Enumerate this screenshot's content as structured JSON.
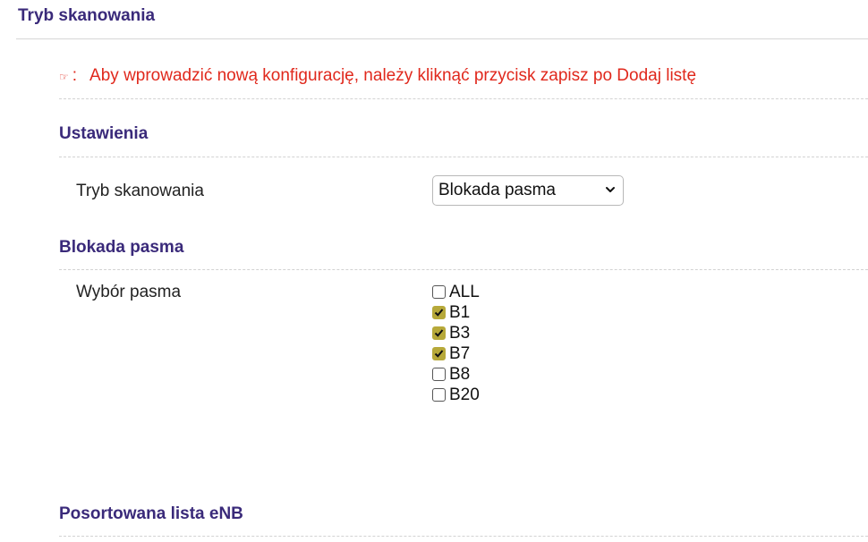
{
  "header": {
    "title": "Tryb skanowania"
  },
  "notice": {
    "icon": "pointing-hand-icon",
    "colon": ":",
    "text": "Aby wprowadzić nową konfigurację, należy kliknąć przycisk zapisz po Dodaj listę",
    "color": "#e0281c"
  },
  "settings": {
    "title": "Ustawienia",
    "scan_mode_label": "Tryb skanowania",
    "scan_mode_value": "Blokada pasma"
  },
  "band_lock": {
    "title": "Blokada pasma",
    "band_select_label": "Wybór pasma",
    "bands": [
      {
        "label": "ALL",
        "checked": false
      },
      {
        "label": "B1",
        "checked": true
      },
      {
        "label": "B3",
        "checked": true
      },
      {
        "label": "B7",
        "checked": true
      },
      {
        "label": "B8",
        "checked": false
      },
      {
        "label": "B20",
        "checked": false
      }
    ]
  },
  "enb_list": {
    "title": "Posortowana lista eNB"
  },
  "colors": {
    "heading": "#3a2a7a",
    "checkbox_checked": "#b7a93a"
  }
}
